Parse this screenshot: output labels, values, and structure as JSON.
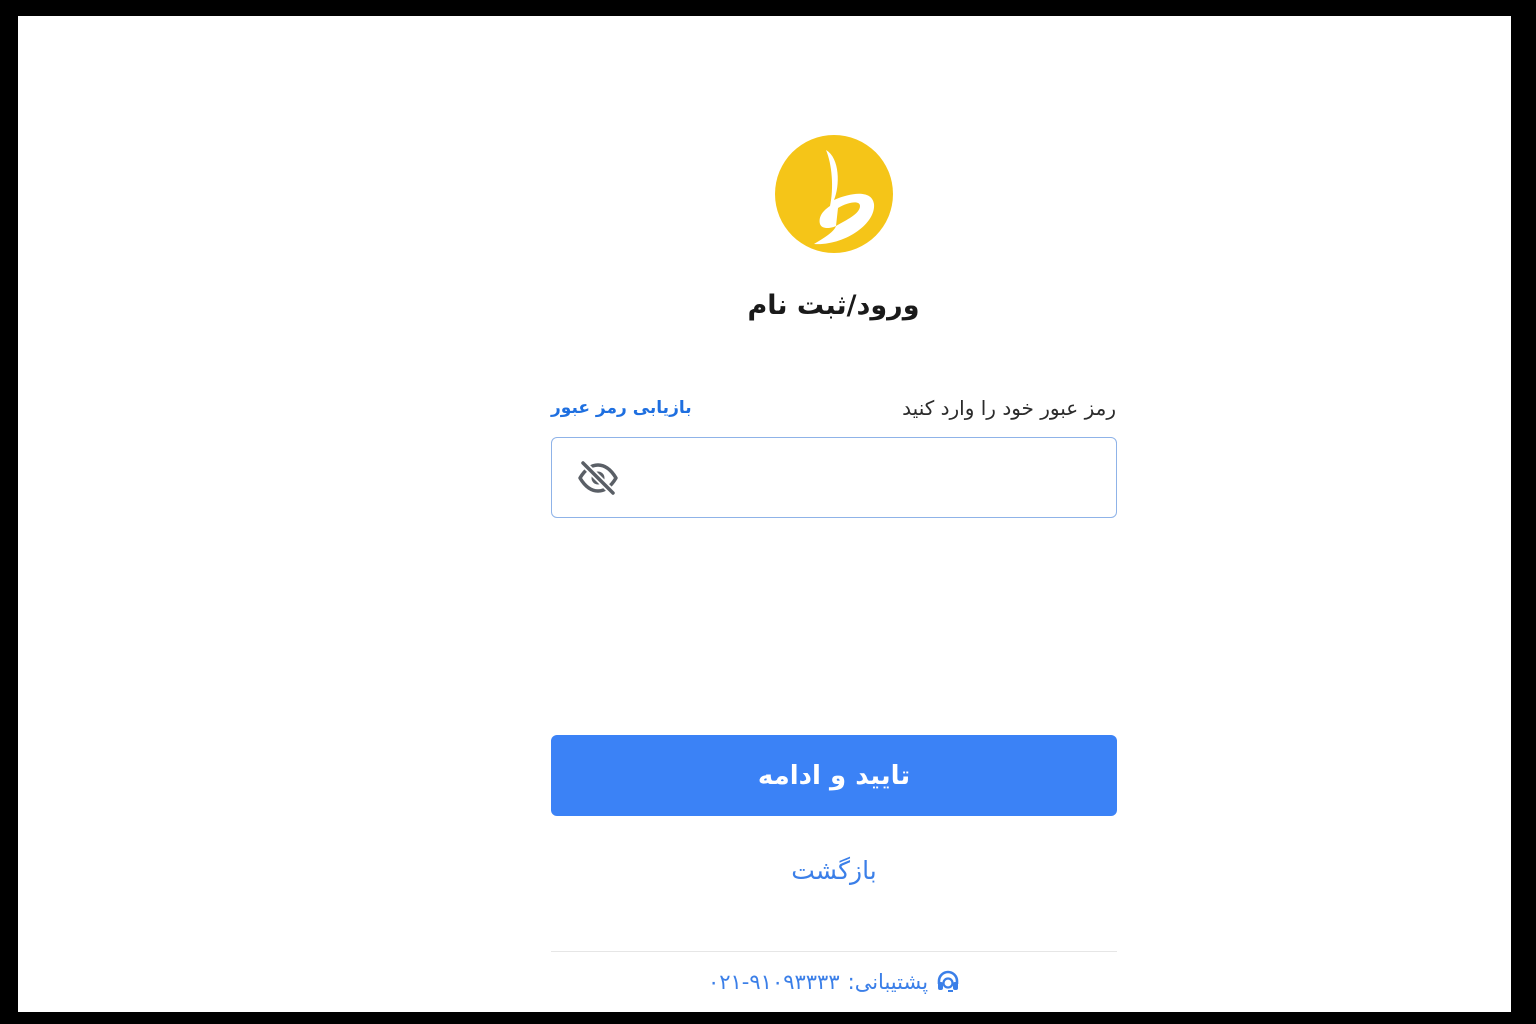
{
  "title": "ورود/ثبت نام",
  "password": {
    "label": "رمز عبور خود را وارد کنید",
    "recover_link": "بازیابی رمز عبور",
    "value": "",
    "placeholder": "",
    "visibility_icon": "eye-slash-icon"
  },
  "actions": {
    "submit_label": "تایید و ادامه",
    "back_label": "بازگشت"
  },
  "support": {
    "label": "پشتیبانی:",
    "phone": "۰۲۱-۹۱۰۹۳۳۳۳",
    "icon": "headset-icon"
  },
  "colors": {
    "brand_yellow": "#f5c518",
    "primary_blue": "#3b82f6",
    "link_blue": "#1e6fe0"
  }
}
